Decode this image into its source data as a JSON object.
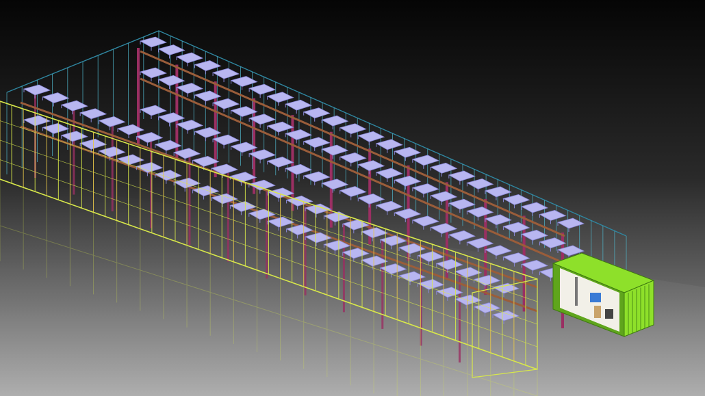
{
  "scene": {
    "subject": "multi-level-rack-storage-with-container-office",
    "background_top": "#050505",
    "background_bottom": "#9a9a9a",
    "colors": {
      "frame_outer": "#d8e84a",
      "frame_side": "#4fb3c8",
      "frame_back": "#2f86a0",
      "pillar": "#9a2f62",
      "beam": "#9a5d3a",
      "tray": "#b8b6f0",
      "tray_dark": "#8a88d8",
      "container": "#8ee02a",
      "container_dark": "#5fa51c",
      "container_interior": "#f2f0e8"
    },
    "icons": [
      "container-office-icon"
    ]
  }
}
